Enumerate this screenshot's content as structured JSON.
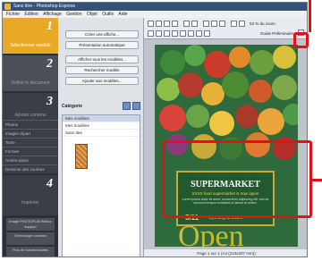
{
  "window": {
    "title": "Sans titre - Photoshop Express"
  },
  "menu": [
    "Fichier",
    "Édition",
    "Affichage",
    "Gestion",
    "Objet",
    "Outils",
    "Aide"
  ],
  "steps": {
    "step1": {
      "num": "1",
      "label": "Sélectionner modèle"
    },
    "step2": {
      "num": "2",
      "label": "Définir le document"
    },
    "step3": {
      "num": "3",
      "label": "Ajouter contenu",
      "items": [
        "Photos",
        "Images clipart",
        "Texte",
        "Formes",
        "Arrière-plans",
        "Dessiner des courbes"
      ]
    },
    "step4": {
      "num": "4",
      "label": "Imprimer"
    },
    "bottom_buttons": [
      "Image PHOTOFUN Retour support",
      "Télécharger contenu",
      "Plus de fonctionnalités"
    ]
  },
  "mid": {
    "buttons": [
      "Créer une affiche...",
      "Présentation automatique",
      "Afficher tous les modèles...",
      "Rechercher modèle",
      "Ajouter aux modèles..."
    ],
    "category_label": "Catégorie",
    "list": [
      "Mes modèles",
      "Mes modèles",
      "Sans titre"
    ]
  },
  "toolbar": {
    "zoom": "53 % du zoom",
    "mode_label": "Guide Préliminaire",
    "size_label": "A4"
  },
  "poster": {
    "sign_title": "SUPERMARKET",
    "sign_subtitle": "XXXX food supermarket is now open!",
    "sign_body": "Lorem ipsum dolor sit amet, consectetur adipiscing elit, sed do eiusmod tempor incididunt ut labore et dolore.",
    "date": "5/11",
    "opening": "Opening at 10am",
    "big_word": "Open"
  },
  "status": "Page 1 sur 1 (A4 (210x297 mm))",
  "colors": {
    "highlight": "#e3101b",
    "accent": "#e9a825"
  }
}
